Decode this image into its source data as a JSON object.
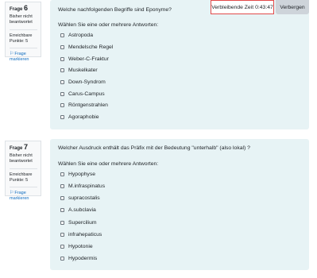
{
  "timer": {
    "label": "Verbleibende Zeit",
    "value": "0:43:47",
    "hide_button": "Verbergen"
  },
  "questions": [
    {
      "frage_label": "Frage",
      "number": "6",
      "state": "Bisher nicht beantwortet",
      "grade": "Erreichbare Punkte: 5",
      "flag": "Frage markieren",
      "text": "Welche nachfolgenden Begriffe sind Eponyme?",
      "prompt": "Wählen Sie eine oder mehrere Antworten:",
      "options": [
        "Astropoda",
        "Mendelsche Regel",
        "Weber-C-Fraktur",
        "Muskelkater",
        "Down-Syndrom",
        "Carus-Campus",
        "Röntgenstrahlen",
        "Agoraphobie"
      ]
    },
    {
      "frage_label": "Frage",
      "number": "7",
      "state": "Bisher nicht beantwortet",
      "grade": "Erreichbare Punkte: 5",
      "flag": "Frage markieren",
      "text": "Welcher Ausdruck enthält das Präfix mit der Bedeutung \"unterhalb\" (also lokal) ?",
      "prompt": "Wählen Sie eine oder mehrere Antworten:",
      "options": [
        "Hypophyse",
        "M.infraspinatus",
        "supracostalis",
        "A.subclavia",
        "Supercilium",
        "infrahepaticus",
        "Hypotonie",
        "Hypodermis"
      ]
    }
  ]
}
